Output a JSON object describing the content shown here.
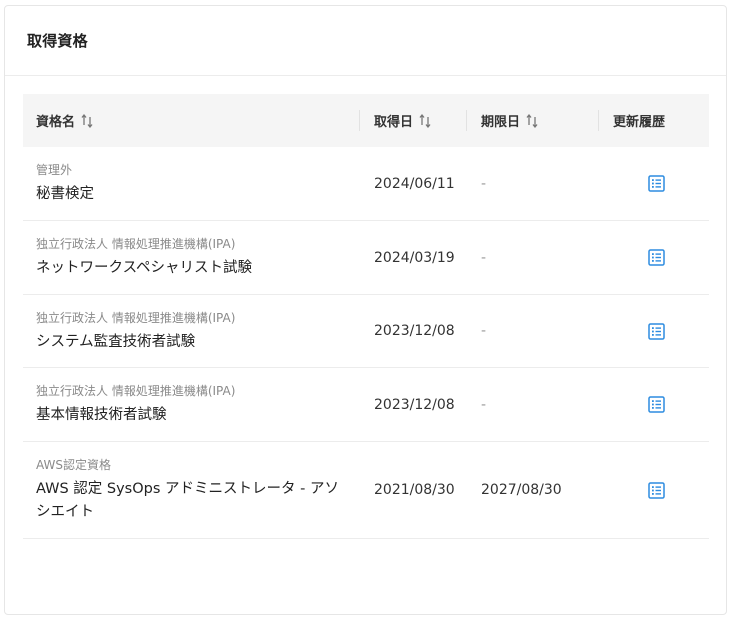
{
  "card": {
    "title": "取得資格"
  },
  "table": {
    "headers": {
      "name": "資格名",
      "acquired": "取得日",
      "expiry": "期限日",
      "history": "更新履歴"
    },
    "rows": [
      {
        "issuer": "管理外",
        "name": "秘書検定",
        "acquired": "2024/06/11",
        "expiry": "-"
      },
      {
        "issuer": "独立行政法人 情報処理推進機構(IPA)",
        "name": "ネットワークスペシャリスト試験",
        "acquired": "2024/03/19",
        "expiry": "-"
      },
      {
        "issuer": "独立行政法人 情報処理推進機構(IPA)",
        "name": "システム監査技術者試験",
        "acquired": "2023/12/08",
        "expiry": "-"
      },
      {
        "issuer": "独立行政法人 情報処理推進機構(IPA)",
        "name": "基本情報技術者試験",
        "acquired": "2023/12/08",
        "expiry": "-"
      },
      {
        "issuer": "AWS認定資格",
        "name": "AWS 認定 SysOps アドミニストレータ - アソシエイト",
        "acquired": "2021/08/30",
        "expiry": "2027/08/30"
      }
    ]
  },
  "colors": {
    "accent": "#2d8ce0",
    "header_bg": "#f5f5f5",
    "border": "#ececec"
  },
  "icons": {
    "sort": "sort-arrows-icon",
    "history": "list-icon"
  }
}
